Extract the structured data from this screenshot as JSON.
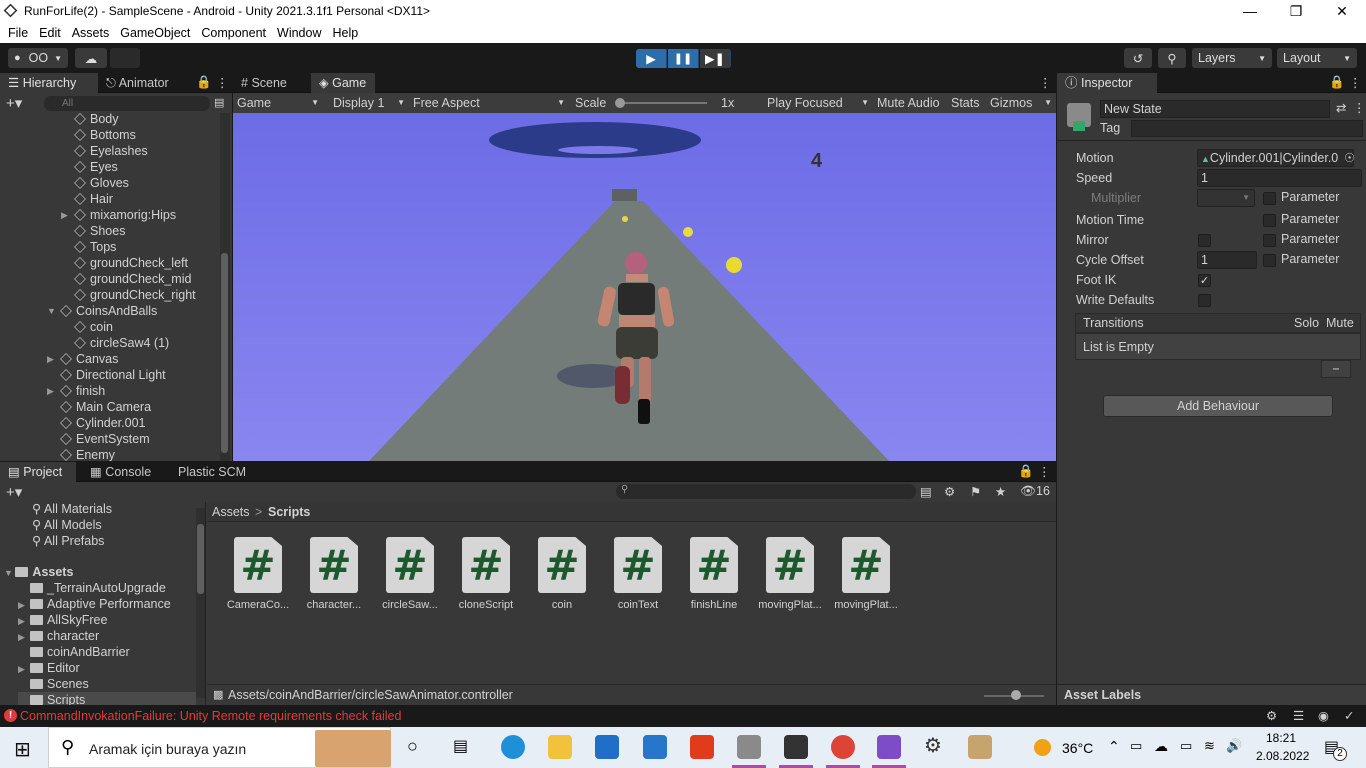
{
  "window": {
    "title": "RunForLife(2) - SampleScene - Android - Unity 2021.3.1f1 Personal <DX11>"
  },
  "menu": [
    "File",
    "Edit",
    "Assets",
    "GameObject",
    "Component",
    "Window",
    "Help"
  ],
  "toolbar": {
    "account": "OO",
    "layers": "Layers",
    "layout": "Layout"
  },
  "hierarchy": {
    "tabs": [
      "Hierarchy",
      "Animator"
    ],
    "search_placeholder": "All",
    "items": [
      {
        "label": "Body",
        "depth": 2
      },
      {
        "label": "Bottoms",
        "depth": 2
      },
      {
        "label": "Eyelashes",
        "depth": 2
      },
      {
        "label": "Eyes",
        "depth": 2
      },
      {
        "label": "Gloves",
        "depth": 2
      },
      {
        "label": "Hair",
        "depth": 2
      },
      {
        "label": "mixamorig:Hips",
        "depth": 2,
        "collapsed": true
      },
      {
        "label": "Shoes",
        "depth": 2
      },
      {
        "label": "Tops",
        "depth": 2
      },
      {
        "label": "groundCheck_left",
        "depth": 2
      },
      {
        "label": "groundCheck_mid",
        "depth": 2
      },
      {
        "label": "groundCheck_right",
        "depth": 2
      },
      {
        "label": "CoinsAndBalls",
        "depth": 1,
        "expanded": true
      },
      {
        "label": "coin",
        "depth": 2
      },
      {
        "label": "circleSaw4 (1)",
        "depth": 2
      },
      {
        "label": "Canvas",
        "depth": 1,
        "collapsed": true
      },
      {
        "label": "Directional Light",
        "depth": 1
      },
      {
        "label": "finish",
        "depth": 1,
        "collapsed": true
      },
      {
        "label": "Main Camera",
        "depth": 1
      },
      {
        "label": "Cylinder.001",
        "depth": 1
      },
      {
        "label": "EventSystem",
        "depth": 1
      },
      {
        "label": "Enemy",
        "depth": 1
      }
    ]
  },
  "game": {
    "tabs": [
      "Scene",
      "Game"
    ],
    "view_mode": "Game",
    "display": "Display 1",
    "aspect": "Free Aspect",
    "scale_label": "Scale",
    "scale_value": "1x",
    "play_mode": "Play Focused",
    "mute": "Mute Audio",
    "stats": "Stats",
    "gizmos": "Gizmos",
    "score": "4",
    "colors": {
      "sky": "#7b79ec",
      "road": "#737c78"
    }
  },
  "inspector": {
    "tab": "Inspector",
    "name": "New State",
    "tag_label": "Tag",
    "motion_label": "Motion",
    "motion_value": "Cylinder.001|Cylinder.0",
    "speed_label": "Speed",
    "speed_value": "1",
    "multiplier_label": "Multiplier",
    "motion_time_label": "Motion Time",
    "mirror_label": "Mirror",
    "cycle_offset_label": "Cycle Offset",
    "cycle_offset_value": "1",
    "foot_ik_label": "Foot IK",
    "write_defaults_label": "Write Defaults",
    "parameter_label": "Parameter",
    "transitions_label": "Transitions",
    "solo_label": "Solo",
    "mute_label": "Mute",
    "list_empty": "List is Empty",
    "minus": "−",
    "add_behaviour": "Add Behaviour",
    "asset_labels": "Asset Labels"
  },
  "project": {
    "tabs": [
      "Project",
      "Console",
      "Plastic SCM"
    ],
    "hidden_count": "16",
    "favorites": [
      "All Materials",
      "All Models",
      "All Prefabs"
    ],
    "assets_root": "Assets",
    "folders": [
      {
        "label": "_TerrainAutoUpgrade",
        "expand": false
      },
      {
        "label": "Adaptive Performance",
        "expand": true
      },
      {
        "label": "AllSkyFree",
        "expand": true
      },
      {
        "label": "character",
        "expand": true
      },
      {
        "label": "coinAndBarrier",
        "expand": false
      },
      {
        "label": "Editor",
        "expand": true
      },
      {
        "label": "Scenes",
        "expand": false
      },
      {
        "label": "Scripts",
        "expand": false
      }
    ],
    "breadcrumb_root": "Assets",
    "breadcrumb_sep": ">",
    "breadcrumb_current": "Scripts",
    "scripts": [
      "CameraCo...",
      "character...",
      "circleSaw...",
      "cloneScript",
      "coin",
      "coinText",
      "finishLine",
      "movingPlat...",
      "movingPlat..."
    ],
    "script_glyph": "#",
    "selected_path": "Assets/coinAndBarrier/circleSawAnimator.controller"
  },
  "status": {
    "error": "CommandInvokationFailure: Unity Remote requirements check failed"
  },
  "taskbar": {
    "search_placeholder": "Aramak için buraya yazın",
    "temperature": "36°C",
    "time": "18:21",
    "date": "2.08.2022",
    "notifications": "2"
  }
}
